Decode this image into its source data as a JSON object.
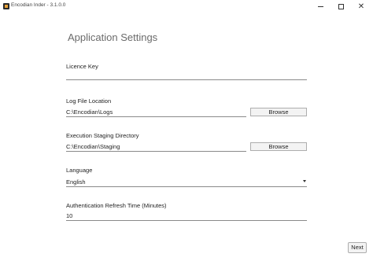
{
  "window": {
    "title": "Encodian Inder - 3.1.0.0",
    "minimize_icon": "minimize-icon",
    "maximize_icon": "maximize-icon",
    "close_icon": "close-icon",
    "close_glyph": "✕"
  },
  "page": {
    "heading": "Application Settings"
  },
  "licence_key": {
    "label": "Licence Key",
    "value": ""
  },
  "log_file": {
    "label": "Log File Location",
    "value": "C:\\Encodian\\Logs",
    "browse_label": "Browse"
  },
  "staging_dir": {
    "label": "Execution Staging Directory",
    "value": "C:\\Encodian\\Staging",
    "browse_label": "Browse"
  },
  "language": {
    "label": "Language",
    "selected": "English",
    "icon": "chevron-down-icon"
  },
  "auth_refresh": {
    "label": "Authentication Refresh Time (Minutes)",
    "value": "10"
  },
  "footer": {
    "next_label": "Next"
  }
}
